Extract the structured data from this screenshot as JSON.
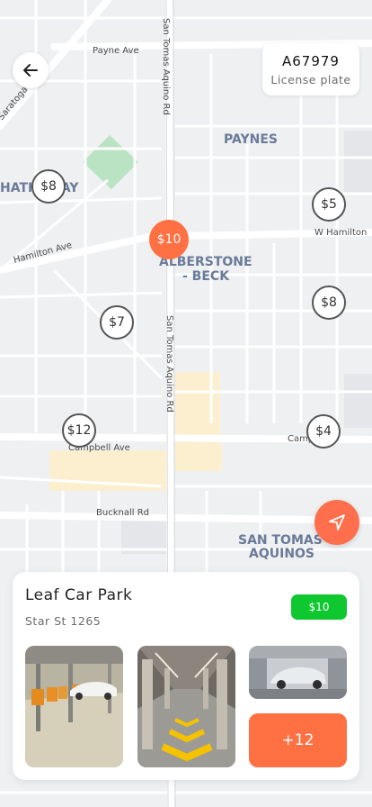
{
  "header": {
    "plate_number": "A67979",
    "plate_label": "License plate"
  },
  "map": {
    "streets": [
      "Payne Ave",
      "San Tomas Aquino Rd",
      "Hamilton Ave",
      "W Hamilton",
      "San Tomas Aquino Rd",
      "Campbell Ave",
      "Camp Ave",
      "Bucknall Rd",
      "Saratoga Av"
    ],
    "areas": [
      "PAYNES",
      "HATHAWAY",
      "ALBERSTONE",
      "- BECK",
      "SAN TOMAS",
      "AQUINOS"
    ],
    "pins": [
      {
        "label": "$8",
        "selected": false
      },
      {
        "label": "$10",
        "selected": true
      },
      {
        "label": "$5",
        "selected": false
      },
      {
        "label": "$8",
        "selected": false
      },
      {
        "label": "$7",
        "selected": false
      },
      {
        "label": "$12",
        "selected": false
      },
      {
        "label": "$4",
        "selected": false
      }
    ]
  },
  "parking": {
    "name": "Leaf Car Park",
    "address": "Star St 1265",
    "price": "$10",
    "more_photos": "+12"
  },
  "colors": {
    "accent": "#ff7043",
    "price_green": "#0fc72e"
  }
}
